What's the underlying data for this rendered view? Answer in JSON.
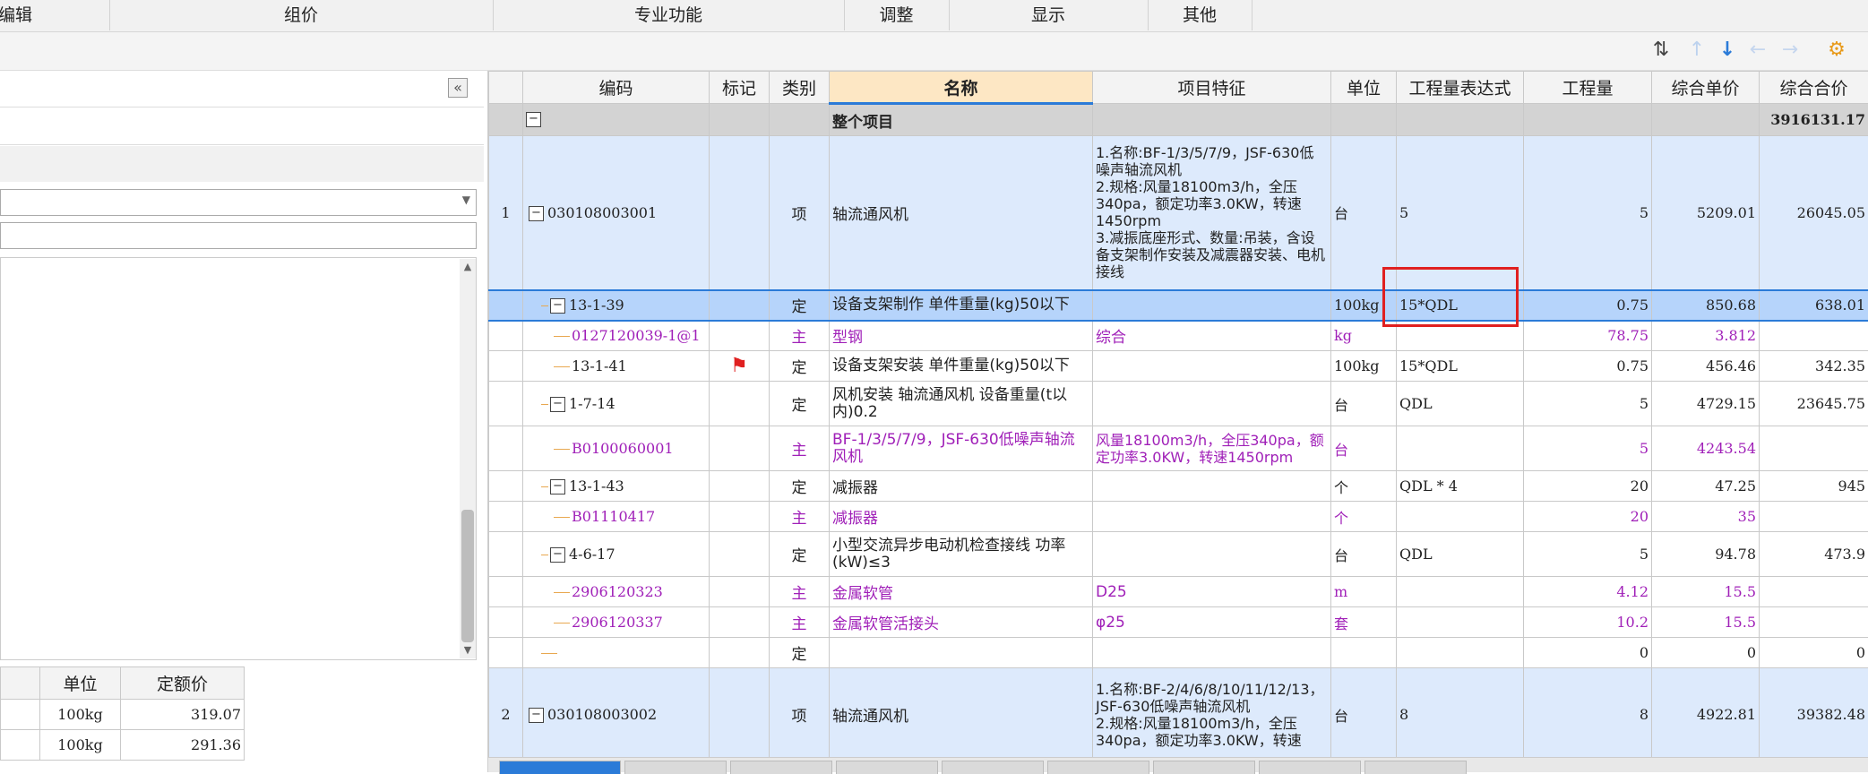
{
  "ribbon": {
    "groups": [
      "编辑",
      "组价",
      "专业功能",
      "调整",
      "显示",
      "其他"
    ]
  },
  "toolbar": {
    "icons": [
      "move-icon",
      "arrow-up-icon",
      "arrow-down-icon",
      "arrow-left-icon",
      "arrow-right-icon",
      "settings-icon"
    ]
  },
  "left_panel": {
    "collapse_label": "«",
    "table_headers": [
      "单位",
      "定额价"
    ],
    "rows": [
      {
        "unit": "100kg",
        "price": "319.07"
      },
      {
        "unit": "100kg",
        "price": "291.36"
      }
    ]
  },
  "grid": {
    "headers": [
      "编码",
      "标记",
      "类别",
      "名称",
      "项目特征",
      "单位",
      "工程量表达式",
      "工程量",
      "综合单价",
      "综合合价"
    ],
    "project_row": {
      "name": "整个项目",
      "total": "3916131.17"
    },
    "rows": [
      {
        "no": "1",
        "code": "030108003001",
        "flag": "",
        "type": "项",
        "name": "轴流通风机",
        "feature": "1.名称:BF-1/3/5/7/9，JSF-630低噪声轴流风机\n2.规格:风量18100m3/h，全压340pa，额定功率3.0KW，转速1450rpm\n3.减振底座形式、数量:吊装，含设备支架制作安装及减震器安装、电机接线",
        "unit": "台",
        "expr": "5",
        "qty": "5",
        "price": "5209.01",
        "total": "26045.05"
      },
      {
        "no": "",
        "code": "13-1-39",
        "flag": "",
        "type": "定",
        "name": "设备支架制作 单件重量(kg)50以下",
        "feature": "",
        "unit": "100kg",
        "expr": "15*QDL",
        "qty": "0.75",
        "price": "850.68",
        "total": "638.01"
      },
      {
        "no": "",
        "code": "0127120039-1@1",
        "flag": "",
        "type": "主",
        "name": "型钢",
        "feature": "综合",
        "unit": "kg",
        "expr": "",
        "qty": "78.75",
        "price": "3.812",
        "total": ""
      },
      {
        "no": "",
        "code": "13-1-41",
        "flag": "flag",
        "type": "定",
        "name": "设备支架安装 单件重量(kg)50以下",
        "feature": "",
        "unit": "100kg",
        "expr": "15*QDL",
        "qty": "0.75",
        "price": "456.46",
        "total": "342.35"
      },
      {
        "no": "",
        "code": "1-7-14",
        "flag": "",
        "type": "定",
        "name": "风机安装 轴流通风机 设备重量(t以内)0.2",
        "feature": "",
        "unit": "台",
        "expr": "QDL",
        "qty": "5",
        "price": "4729.15",
        "total": "23645.75"
      },
      {
        "no": "",
        "code": "B0100060001",
        "flag": "",
        "type": "主",
        "name": "BF-1/3/5/7/9，JSF-630低噪声轴流风机",
        "feature": "风量18100m3/h，全压340pa，额定功率3.0KW，转速1450rpm",
        "unit": "台",
        "expr": "",
        "qty": "5",
        "price": "4243.54",
        "total": ""
      },
      {
        "no": "",
        "code": "13-1-43",
        "flag": "",
        "type": "定",
        "name": "减振器",
        "feature": "",
        "unit": "个",
        "expr": "QDL * 4",
        "qty": "20",
        "price": "47.25",
        "total": "945"
      },
      {
        "no": "",
        "code": "B01110417",
        "flag": "",
        "type": "主",
        "name": "减振器",
        "feature": "",
        "unit": "个",
        "expr": "",
        "qty": "20",
        "price": "35",
        "total": ""
      },
      {
        "no": "",
        "code": "4-6-17",
        "flag": "",
        "type": "定",
        "name": "小型交流异步电动机检查接线 功率(kW)≤3",
        "feature": "",
        "unit": "台",
        "expr": "QDL",
        "qty": "5",
        "price": "94.78",
        "total": "473.9"
      },
      {
        "no": "",
        "code": "2906120323",
        "flag": "",
        "type": "主",
        "name": "金属软管",
        "feature": "D25",
        "unit": "m",
        "expr": "",
        "qty": "4.12",
        "price": "15.5",
        "total": ""
      },
      {
        "no": "",
        "code": "2906120337",
        "flag": "",
        "type": "主",
        "name": "金属软管活接头",
        "feature": "φ25",
        "unit": "套",
        "expr": "",
        "qty": "10.2",
        "price": "15.5",
        "total": ""
      },
      {
        "no": "",
        "code": "",
        "flag": "",
        "type": "定",
        "name": "",
        "feature": "",
        "unit": "",
        "expr": "",
        "qty": "0",
        "price": "0",
        "total": "0"
      },
      {
        "no": "2",
        "code": "030108003002",
        "flag": "",
        "type": "项",
        "name": "轴流通风机",
        "feature": "1.名称:BF-2/4/6/8/10/11/12/13，JSF-630低噪声轴流风机\n2.规格:风量18100m3/h，全压340pa，额定功率3.0KW，转速",
        "unit": "台",
        "expr": "8",
        "qty": "8",
        "price": "4922.81",
        "total": "39382.48"
      }
    ]
  },
  "colors": {
    "accent": "#2b7bd8",
    "highlight_box": "#e02020",
    "main_material": "#a020b8"
  }
}
